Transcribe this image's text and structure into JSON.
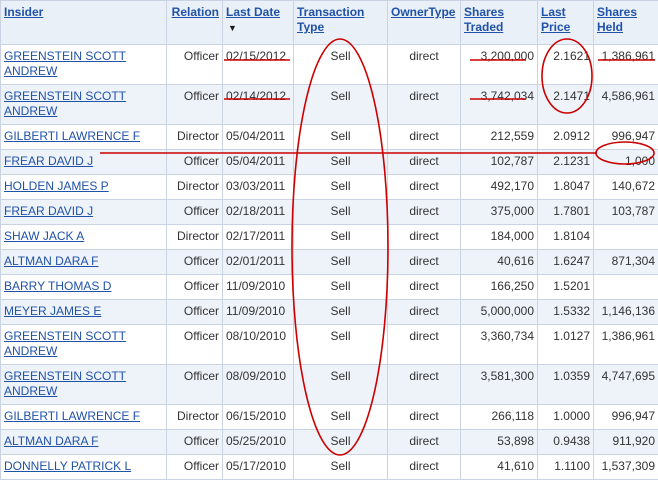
{
  "headers": {
    "insider": "Insider",
    "relation": "Relation",
    "last_date": "Last Date",
    "transaction_type": "Transaction Type",
    "owner_type": "OwnerType",
    "shares_traded": "Shares Traded",
    "last_price": "Last Price",
    "shares_held": "Shares Held"
  },
  "rows": [
    {
      "insider": "GREENSTEIN SCOTT ANDREW",
      "relation": "Officer",
      "date": "02/15/2012",
      "type": "Sell",
      "owner": "direct",
      "traded": "3,200,000",
      "price": "2.1621",
      "held": "1,386,961"
    },
    {
      "insider": "GREENSTEIN SCOTT ANDREW",
      "relation": "Officer",
      "date": "02/14/2012",
      "type": "Sell",
      "owner": "direct",
      "traded": "3,742,034",
      "price": "2.1471",
      "held": "4,586,961"
    },
    {
      "insider": "GILBERTI LAWRENCE F",
      "relation": "Director",
      "date": "05/04/2011",
      "type": "Sell",
      "owner": "direct",
      "traded": "212,559",
      "price": "2.0912",
      "held": "996,947"
    },
    {
      "insider": "FREAR DAVID J",
      "relation": "Officer",
      "date": "05/04/2011",
      "type": "Sell",
      "owner": "direct",
      "traded": "102,787",
      "price": "2.1231",
      "held": "1,000"
    },
    {
      "insider": "HOLDEN JAMES P",
      "relation": "Director",
      "date": "03/03/2011",
      "type": "Sell",
      "owner": "direct",
      "traded": "492,170",
      "price": "1.8047",
      "held": "140,672"
    },
    {
      "insider": "FREAR DAVID J",
      "relation": "Officer",
      "date": "02/18/2011",
      "type": "Sell",
      "owner": "direct",
      "traded": "375,000",
      "price": "1.7801",
      "held": "103,787"
    },
    {
      "insider": "SHAW JACK A",
      "relation": "Director",
      "date": "02/17/2011",
      "type": "Sell",
      "owner": "direct",
      "traded": "184,000",
      "price": "1.8104",
      "held": ""
    },
    {
      "insider": "ALTMAN DARA F",
      "relation": "Officer",
      "date": "02/01/2011",
      "type": "Sell",
      "owner": "direct",
      "traded": "40,616",
      "price": "1.6247",
      "held": "871,304"
    },
    {
      "insider": "BARRY THOMAS D",
      "relation": "Officer",
      "date": "11/09/2010",
      "type": "Sell",
      "owner": "direct",
      "traded": "166,250",
      "price": "1.5201",
      "held": ""
    },
    {
      "insider": "MEYER JAMES E",
      "relation": "Officer",
      "date": "11/09/2010",
      "type": "Sell",
      "owner": "direct",
      "traded": "5,000,000",
      "price": "1.5332",
      "held": "1,146,136"
    },
    {
      "insider": "GREENSTEIN SCOTT ANDREW",
      "relation": "Officer",
      "date": "08/10/2010",
      "type": "Sell",
      "owner": "direct",
      "traded": "3,360,734",
      "price": "1.0127",
      "held": "1,386,961"
    },
    {
      "insider": "GREENSTEIN SCOTT ANDREW",
      "relation": "Officer",
      "date": "08/09/2010",
      "type": "Sell",
      "owner": "direct",
      "traded": "3,581,300",
      "price": "1.0359",
      "held": "4,747,695"
    },
    {
      "insider": "GILBERTI LAWRENCE F",
      "relation": "Director",
      "date": "06/15/2010",
      "type": "Sell",
      "owner": "direct",
      "traded": "266,118",
      "price": "1.0000",
      "held": "996,947"
    },
    {
      "insider": "ALTMAN DARA F",
      "relation": "Officer",
      "date": "05/25/2010",
      "type": "Sell",
      "owner": "direct",
      "traded": "53,898",
      "price": "0.9438",
      "held": "911,920"
    },
    {
      "insider": "DONNELLY PATRICK L",
      "relation": "Officer",
      "date": "05/17/2010",
      "type": "Sell",
      "owner": "direct",
      "traded": "41,610",
      "price": "1.1100",
      "held": "1,537,309"
    }
  ],
  "sort": {
    "column": "last_date",
    "indicator": "sort-descending-arrow-icon"
  },
  "annotation_color": "#cc0000",
  "colors": {
    "header_bg": "#eaf0f8",
    "alt_row_bg": "#eef3fa",
    "link": "#2052a8",
    "border": "#c9d3e3"
  }
}
